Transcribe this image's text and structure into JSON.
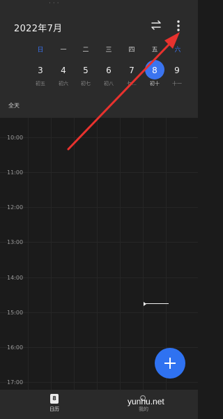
{
  "header": {
    "month_title": "2022年7月"
  },
  "week": {
    "weekdays": [
      "日",
      "一",
      "二",
      "三",
      "四",
      "五",
      "六"
    ],
    "dates": [
      {
        "day": "3",
        "lunar": "初五"
      },
      {
        "day": "4",
        "lunar": "初六"
      },
      {
        "day": "5",
        "lunar": "初七"
      },
      {
        "day": "6",
        "lunar": "初八"
      },
      {
        "day": "7",
        "lunar": "七…"
      },
      {
        "day": "8",
        "lunar": "初十"
      },
      {
        "day": "9",
        "lunar": "十一"
      }
    ],
    "selected_index": 5
  },
  "allday_label": "全天",
  "timeline": {
    "times": [
      "10:00",
      "11:00",
      "12:00",
      "13:00",
      "14:00",
      "15:00",
      "16:00",
      "17:00"
    ]
  },
  "bottom_nav": {
    "calendar_icon_day": "8",
    "calendar_label": "日历",
    "mine_label": "我的"
  },
  "watermark": "yunhu.net",
  "colors": {
    "accent": "#3b74ef",
    "arrow": "#e8322e",
    "background": "#1b1b1b",
    "header": "#2b2b2b"
  },
  "icons": {
    "switch": "swap-arrows-icon",
    "more": "more-vertical-icon",
    "add": "plus-icon",
    "calendar": "calendar-icon",
    "mine": "search-person-icon"
  }
}
